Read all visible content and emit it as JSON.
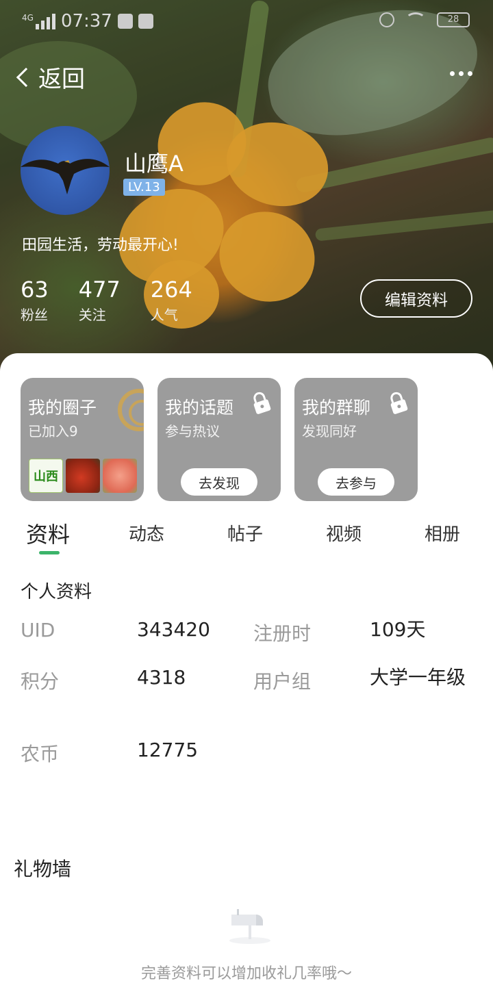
{
  "status_bar": {
    "network": "4G",
    "time": "07:37",
    "battery": "28"
  },
  "nav": {
    "back_label": "返回"
  },
  "profile": {
    "username": "山鹰A",
    "level": "LV.13",
    "bio": "田园生活，劳动最开心!",
    "stats": [
      {
        "value": "63",
        "label": "粉丝"
      },
      {
        "value": "477",
        "label": "关注"
      },
      {
        "value": "264",
        "label": "人气"
      }
    ],
    "edit_label": "编辑资料"
  },
  "cards": [
    {
      "title": "我的圈子",
      "subtitle": "已加入9",
      "thumb_label": "山西"
    },
    {
      "title": "我的话题",
      "subtitle": "参与热议",
      "button": "去发现"
    },
    {
      "title": "我的群聊",
      "subtitle": "发现同好",
      "button": "去参与"
    }
  ],
  "tabs": [
    "资料",
    "动态",
    "帖子",
    "视频",
    "相册"
  ],
  "active_tab": "资料",
  "info": {
    "section_title": "个人资料",
    "rows": [
      {
        "label": "UID",
        "value": "343420"
      },
      {
        "label": "注册时",
        "value": "109天"
      },
      {
        "label": "积分",
        "value": "4318"
      },
      {
        "label": "用户组",
        "value": "大学一年级"
      },
      {
        "label": "农币",
        "value": "12775"
      }
    ]
  },
  "gifts": {
    "section_title": "礼物墙",
    "empty_text": "完善资料可以增加收礼几率哦～"
  },
  "colors": {
    "accent": "#3cb46a",
    "level_badge": "#7fb2e8",
    "card_bg": "#9c9c9c"
  }
}
